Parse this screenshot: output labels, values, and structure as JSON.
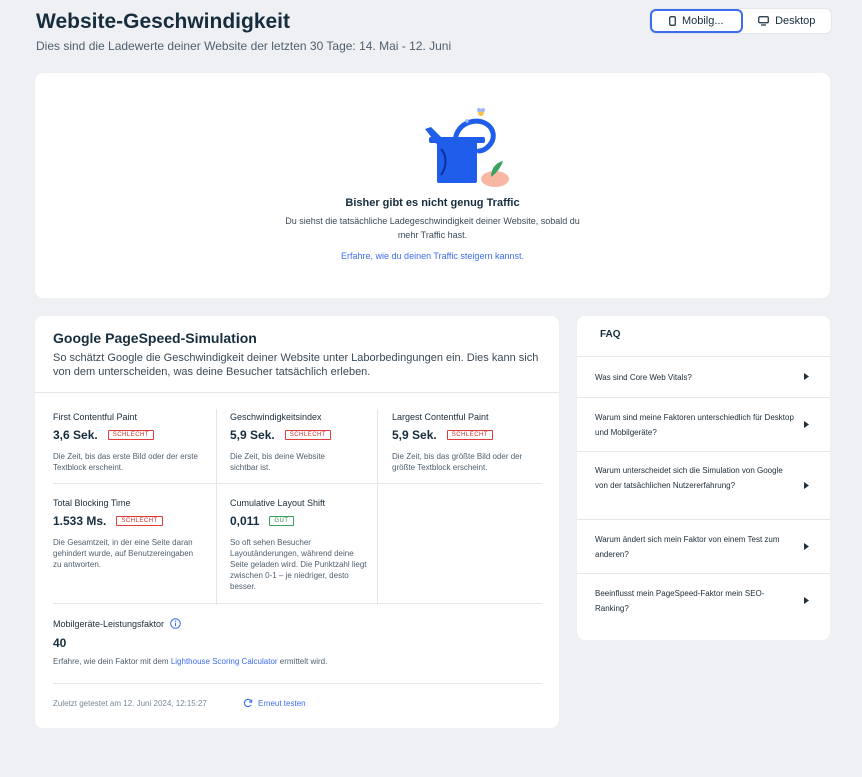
{
  "header": {
    "title": "Website-Geschwindigkeit",
    "subtitle": "Dies sind die Ladewerte deiner Website der letzten 30 Tage: 14. Mai - 12. Juni"
  },
  "device_toggle": {
    "mobile_label": "Mobilg...",
    "desktop_label": "Desktop",
    "selected": "mobile"
  },
  "traffic": {
    "title": "Bisher gibt es nicht genug Traffic",
    "description": "Du siehst die tatsächliche Ladegeschwindigkeit deiner Website, sobald du mehr Traffic hast.",
    "link": "Erfahre, wie du deinen Traffic steigern kannst."
  },
  "psi": {
    "title": "Google PageSpeed-Simulation",
    "description": "So schätzt Google die Geschwindigkeit deiner Website unter Laborbedingungen ein. Dies kann sich von dem unterscheiden, was deine Besucher tatsächlich erleben.",
    "metrics": [
      {
        "name": "First Contentful Paint",
        "value": "3,6 Sek.",
        "badge": "SCHLECHT",
        "status": "bad",
        "description": "Die Zeit, bis das erste Bild oder der erste Textblock erscheint."
      },
      {
        "name": "Geschwindigkeitsindex",
        "value": "5,9 Sek.",
        "badge": "SCHLECHT",
        "status": "bad",
        "description": "Die Zeit, bis deine Website sichtbar ist."
      },
      {
        "name": "Largest Contentful Paint",
        "value": "5,9 Sek.",
        "badge": "SCHLECHT",
        "status": "bad",
        "description": "Die Zeit, bis das größte Bild oder der größte Textblock erscheint."
      },
      {
        "name": "Total Blocking Time",
        "value": "1.533 Ms.",
        "badge": "SCHLECHT",
        "status": "bad",
        "description": "Die Gesamtzeit, in der eine Seite daran gehindert wurde, auf Benutzereingaben zu antworten."
      },
      {
        "name": "Cumulative Layout Shift",
        "value": "0,011",
        "badge": "GUT",
        "status": "good",
        "description": "So oft sehen Besucher Layoutänderungen, während deine Seite geladen wird. Die Punktzahl liegt zwischen 0-1 – je niedriger, desto besser."
      }
    ],
    "score_label": "Mobilgeräte-Leistungsfaktor",
    "score_value": "40",
    "score_note_prefix": "Erfahre, wie dein Faktor mit dem ",
    "score_note_link": "Lighthouse Scoring Calculator",
    "score_note_suffix": " ermittelt wird.",
    "last_tested": "Zuletzt getestet am 12. Juni 2024, 12:15:27",
    "retest_label": "Erneut testen"
  },
  "faq": {
    "title": "FAQ",
    "items": [
      {
        "question": "Was sind Core Web Vitals?"
      },
      {
        "question": "Warum sind meine Faktoren unterschiedlich für Desktop und Mobilgeräte?"
      },
      {
        "question": "Warum unterscheidet sich die Simulation von Google von der tatsächlichen Nutzererfahrung?"
      },
      {
        "question": "Warum ändert sich mein Faktor von einem Test zum anderen?"
      },
      {
        "question": "Beeinflusst mein PageSpeed-Faktor mein SEO-Ranking?"
      }
    ]
  },
  "colors": {
    "accent": "#3d6cf0",
    "bad": "#d12d2d",
    "good": "#2e8a4b",
    "background": "#eef0f4",
    "illustration_blue": "#1f5eea",
    "illustration_pink": "#f7b7a3",
    "illustration_green": "#3aa35f"
  }
}
